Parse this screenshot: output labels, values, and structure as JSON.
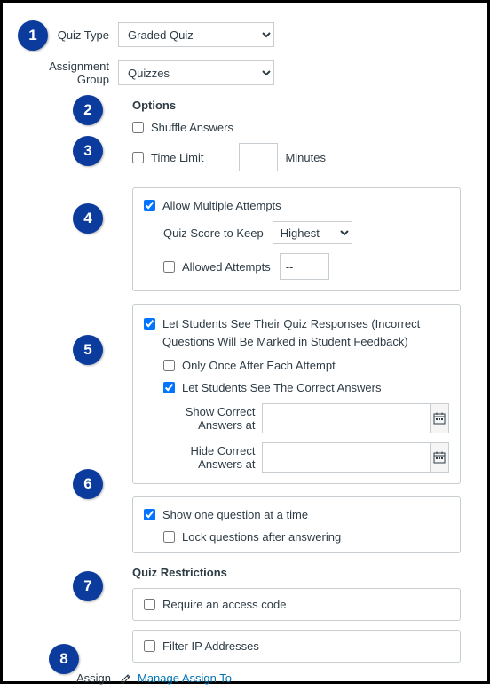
{
  "labels": {
    "quiz_type": "Quiz Type",
    "assignment_group": "Assignment Group",
    "options": "Options",
    "shuffle_answers": "Shuffle Answers",
    "time_limit": "Time Limit",
    "minutes": "Minutes",
    "allow_multiple": "Allow Multiple Attempts",
    "score_to_keep": "Quiz Score to Keep",
    "allowed_attempts": "Allowed Attempts",
    "see_responses": "Let Students See Their Quiz Responses (Incorrect Questions Will Be Marked in Student Feedback)",
    "only_once": "Only Once After Each Attempt",
    "see_correct": "Let Students See The Correct Answers",
    "show_correct_at": "Show Correct Answers at",
    "hide_correct_at": "Hide Correct Answers at",
    "one_question": "Show one question at a time",
    "lock_questions": "Lock questions after answering",
    "quiz_restrictions": "Quiz Restrictions",
    "require_code": "Require an access code",
    "filter_ip": "Filter IP Addresses",
    "assign": "Assign",
    "manage_assign": "Manage Assign To"
  },
  "values": {
    "quiz_type_selected": "Graded Quiz",
    "assignment_group_selected": "Quizzes",
    "score_keep_selected": "Highest",
    "attempts_value": "--",
    "time_limit_value": "",
    "show_correct_value": "",
    "hide_correct_value": ""
  },
  "badges": {
    "b1": "1",
    "b2": "2",
    "b3": "3",
    "b4": "4",
    "b5": "5",
    "b6": "6",
    "b7": "7",
    "b8": "8"
  }
}
